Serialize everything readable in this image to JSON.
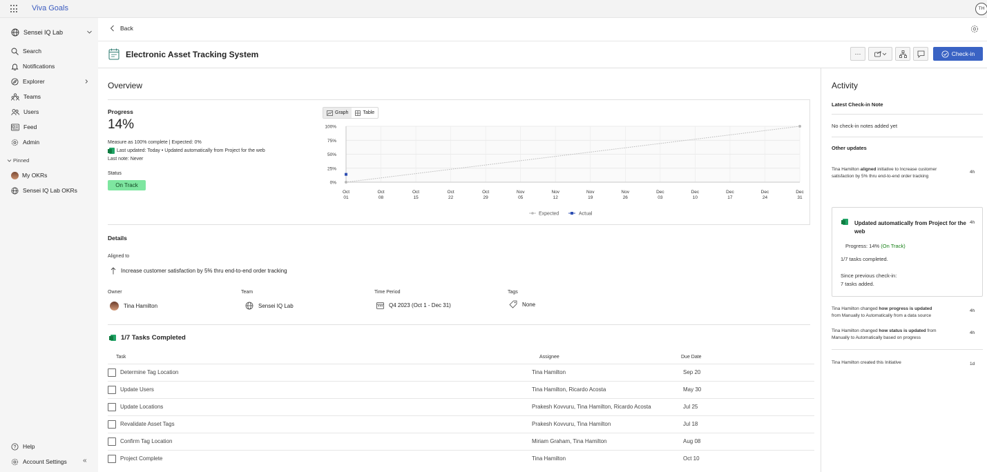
{
  "app": {
    "title": "Viva Goals",
    "user_initials": "TH"
  },
  "sidebar": {
    "org": "Sensei IQ Lab",
    "items": [
      {
        "label": "Search"
      },
      {
        "label": "Notifications"
      },
      {
        "label": "Explorer"
      },
      {
        "label": "Teams"
      },
      {
        "label": "Users"
      },
      {
        "label": "Feed"
      },
      {
        "label": "Admin"
      }
    ],
    "pinned_label": "Pinned",
    "pinned": [
      {
        "label": "My OKRs"
      },
      {
        "label": "Sensei IQ Lab OKRs"
      }
    ],
    "help": "Help",
    "account_settings": "Account Settings"
  },
  "header": {
    "back": "Back",
    "title": "Electronic Asset Tracking System",
    "more": "···",
    "checkin": "Check-in"
  },
  "overview": {
    "title": "Overview",
    "progress_label": "Progress",
    "progress_value": "14%",
    "measure": "Measure as 100% complete | Expected: 0%",
    "last_updated": "Last updated: Today • Updated automatically from Project for the web",
    "last_note": "Last note: Never",
    "status_label": "Status",
    "status": "On Track",
    "tab_graph": "Graph",
    "tab_table": "Table"
  },
  "chart_data": {
    "type": "line",
    "x": [
      "Oct 01",
      "Oct 08",
      "Oct 15",
      "Oct 22",
      "Oct 29",
      "Nov 05",
      "Nov 12",
      "Nov 19",
      "Nov 26",
      "Dec 03",
      "Dec 10",
      "Dec 17",
      "Dec 24",
      "Dec 31"
    ],
    "tick_month": [
      "Oct",
      "Oct",
      "Oct",
      "Oct",
      "Oct",
      "Nov",
      "Nov",
      "Nov",
      "Nov",
      "Dec",
      "Dec",
      "Dec",
      "Dec",
      "Dec"
    ],
    "tick_day": [
      "01",
      "08",
      "15",
      "22",
      "29",
      "05",
      "12",
      "19",
      "26",
      "03",
      "10",
      "17",
      "24",
      "31"
    ],
    "y_ticks": [
      "100%",
      "75%",
      "50%",
      "25%",
      "0%"
    ],
    "ylim": [
      0,
      100
    ],
    "series": [
      {
        "name": "Expected",
        "x": [
          "Oct 01",
          "Dec 31"
        ],
        "values": [
          0,
          100
        ],
        "color": "#b8b8b8"
      },
      {
        "name": "Actual",
        "x": [
          "Oct 01"
        ],
        "values": [
          14
        ],
        "color": "#2f4fb3"
      }
    ],
    "legend": "bottom",
    "grid": true
  },
  "details": {
    "title": "Details",
    "aligned_label": "Aligned to",
    "aligned_value": "Increase customer satisfaction by 5% thru end-to-end order tracking",
    "owner_label": "Owner",
    "owner": "Tina Hamilton",
    "team_label": "Team",
    "team": "Sensei IQ Lab",
    "period_label": "Time Period",
    "period": "Q4 2023 (Oct 1 - Dec 31)",
    "tags_label": "Tags",
    "tags": "None"
  },
  "tasks": {
    "title": "1/7 Tasks Completed",
    "col_task": "Task",
    "col_assignee": "Assignee",
    "col_due": "Due Date",
    "rows": [
      {
        "task": "Determine Tag Location",
        "assignee": "Tina Hamilton",
        "due": "Sep 20"
      },
      {
        "task": "Update Users",
        "assignee": "Tina Hamilton, Ricardo Acosta",
        "due": "May 30"
      },
      {
        "task": "Update Locations",
        "assignee": "Prakesh Kovvuru, Tina Hamilton, Ricardo Acosta",
        "due": "Jul 25"
      },
      {
        "task": "Revalidate Asset Tags",
        "assignee": "Prakesh Kovvuru, Tina Hamilton",
        "due": "Jul 18"
      },
      {
        "task": "Confirm Tag Location",
        "assignee": "Miriam Graham, Tina Hamilton",
        "due": "Aug 08"
      },
      {
        "task": "Project Complete",
        "assignee": "Tina Hamilton",
        "due": "Oct 10"
      }
    ]
  },
  "activity": {
    "title": "Activity",
    "latest_label": "Latest Check-in Note",
    "no_notes": "No check-in notes added yet",
    "other_label": "Other updates",
    "u1_name": "Tina Hamilton",
    "u1_bold": "aligned",
    "u1_rest": "initiative to Increase customer",
    "u1_line2": "satisfaction by 5% thru end-to-end order tracking",
    "u1_time": "4h",
    "card_title": "Updated automatically from Project for the web",
    "card_time": "4h",
    "card_progress": "Progress: 14%",
    "card_status": "(On Track)",
    "card_tasks": "1/7 tasks completed.",
    "card_since": "Since previous check-in:",
    "card_added": "7 tasks added.",
    "u2_name": "Tina Hamilton changed",
    "u2_bold": "how progress is updated",
    "u2_line2": "from Manually to Automatically from a data source",
    "u2_time": "4h",
    "u3_name": "Tina Hamilton changed",
    "u3_bold": "how status is updated",
    "u3_rest": "from",
    "u3_line2": "Manually to Automatically based on progress",
    "u3_time": "4h",
    "u4": "Tina Hamilton created this Initiative",
    "u4_time": "1d"
  }
}
